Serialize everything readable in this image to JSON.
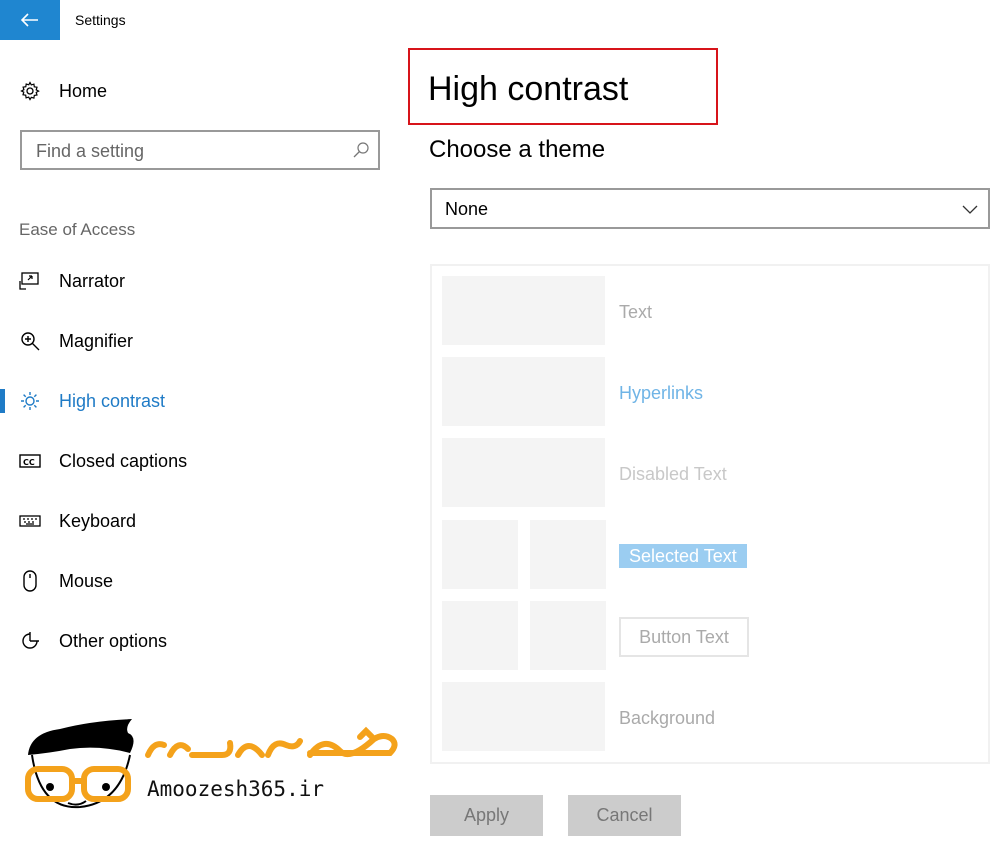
{
  "window": {
    "title": "Settings"
  },
  "sidebar": {
    "home_label": "Home",
    "search_placeholder": "Find a setting",
    "section_title": "Ease of Access",
    "items": [
      {
        "label": "Narrator",
        "icon": "narrator-icon"
      },
      {
        "label": "Magnifier",
        "icon": "magnifier-icon"
      },
      {
        "label": "High contrast",
        "icon": "brightness-icon",
        "active": true
      },
      {
        "label": "Closed captions",
        "icon": "cc-icon"
      },
      {
        "label": "Keyboard",
        "icon": "keyboard-icon"
      },
      {
        "label": "Mouse",
        "icon": "mouse-icon"
      },
      {
        "label": "Other options",
        "icon": "other-options-icon"
      }
    ]
  },
  "main": {
    "title": "High contrast",
    "choose_theme_label": "Choose a theme",
    "theme_selected": "None",
    "preview": {
      "text": "Text",
      "hyperlinks": "Hyperlinks",
      "disabled_text": "Disabled Text",
      "selected_text": "Selected Text",
      "button_text": "Button Text",
      "background": "Background"
    },
    "apply_label": "Apply",
    "cancel_label": "Cancel"
  },
  "watermark": {
    "text": "Amoozesh365.ir",
    "persian_text": "آموزش ۳۶۵"
  },
  "colors": {
    "accent": "#1f86d0",
    "active_text": "#1f7bc6",
    "highlight_border": "#d7141a",
    "logo_orange": "#f4a21b"
  }
}
